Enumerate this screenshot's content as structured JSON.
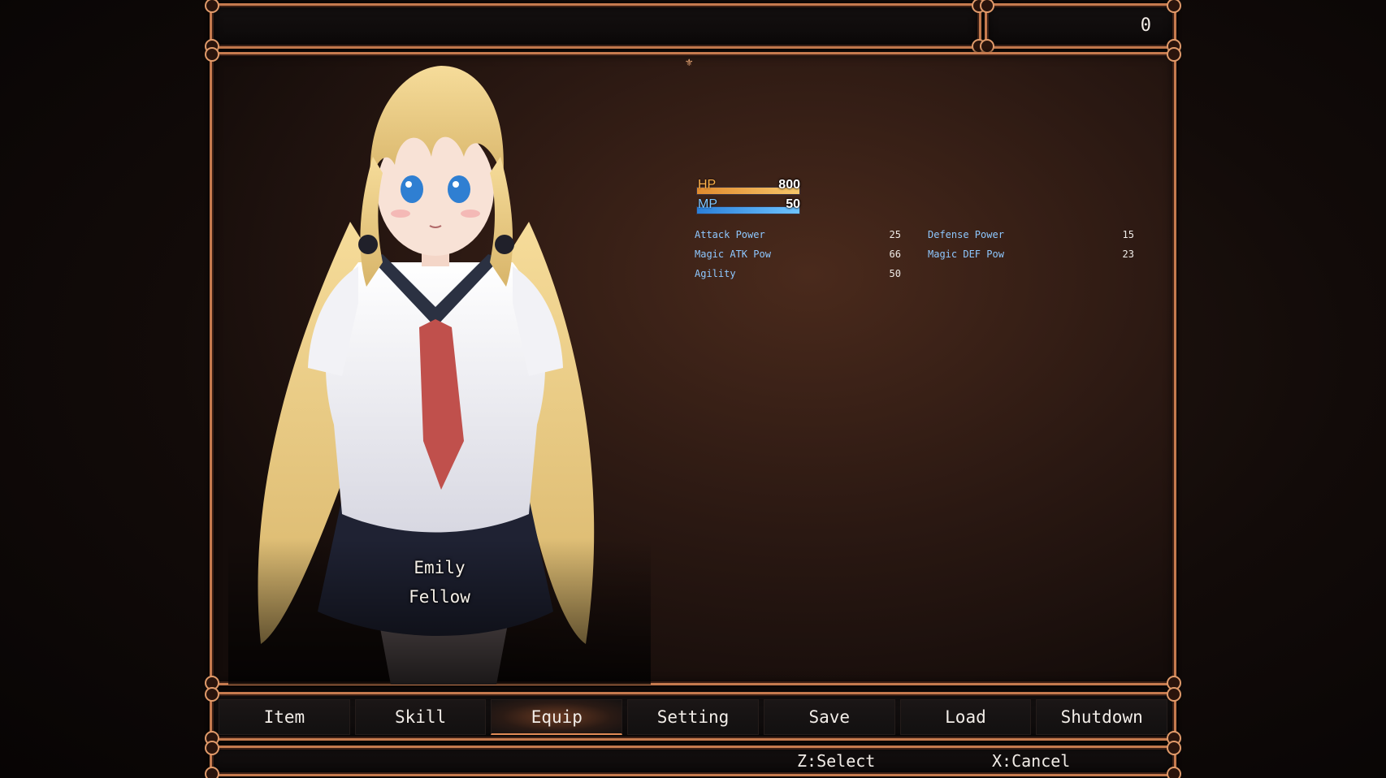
{
  "gold": {
    "value": "0"
  },
  "actor": {
    "name": "Emily",
    "class": "Fellow"
  },
  "gauges": {
    "hp": {
      "label": "HP",
      "value": "800",
      "fill": 1.0,
      "label_color": "#ffb24a",
      "color_from": "#e08a2e",
      "color_to": "#f6c66a"
    },
    "mp": {
      "label": "MP",
      "value": "50",
      "fill": 1.0,
      "label_color": "#7ec6ff",
      "color_from": "#2b7fd8",
      "color_to": "#6ec4ff"
    }
  },
  "params": {
    "atk": {
      "label": "Attack Power",
      "value": "25"
    },
    "def": {
      "label": "Defense Power",
      "value": "15"
    },
    "mat": {
      "label": "Magic ATK Pow",
      "value": "66"
    },
    "mdf": {
      "label": "Magic DEF Pow",
      "value": "23"
    },
    "agi": {
      "label": "Agility",
      "value": "50"
    }
  },
  "menu": {
    "items": [
      {
        "label": "Item"
      },
      {
        "label": "Skill"
      },
      {
        "label": "Equip"
      },
      {
        "label": "Setting"
      },
      {
        "label": "Save"
      },
      {
        "label": "Load"
      },
      {
        "label": "Shutdown"
      }
    ],
    "selected_index": 2
  },
  "help": {
    "select": "Z:Select",
    "cancel": "X:Cancel"
  },
  "colors": {
    "frame": "#c57a4e",
    "param_label": "#8ec8ff",
    "selected_underline": "#e08a55"
  },
  "icons": {
    "top_ornament": "fleur-ornament-icon",
    "frame_corners": "corner-ornament-icon"
  }
}
